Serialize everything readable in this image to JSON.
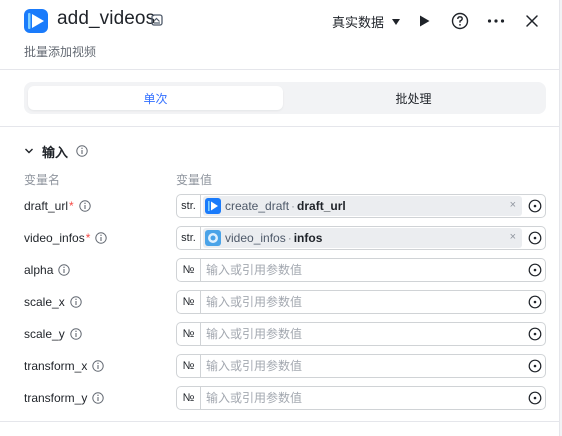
{
  "header": {
    "title": "add_videos",
    "subtitle": "批量添加视频",
    "data_mode": "真实数据"
  },
  "tabs": [
    {
      "label": "单次",
      "active": true
    },
    {
      "label": "批处理",
      "active": false
    }
  ],
  "section": {
    "title": "输入",
    "col_name": "变量名",
    "col_value": "变量值"
  },
  "params": [
    {
      "name": "draft_url",
      "required": true,
      "type_tag": "str.",
      "ref_node": "create_draft",
      "ref_var": "draft_url",
      "placeholder": ""
    },
    {
      "name": "video_infos",
      "required": true,
      "type_tag": "str.",
      "ref_node": "video_infos",
      "ref_var": "infos",
      "placeholder": ""
    },
    {
      "name": "alpha",
      "required": false,
      "type_tag": "№",
      "placeholder": "输入或引用参数值"
    },
    {
      "name": "scale_x",
      "required": false,
      "type_tag": "№",
      "placeholder": "输入或引用参数值"
    },
    {
      "name": "scale_y",
      "required": false,
      "type_tag": "№",
      "placeholder": "输入或引用参数值"
    },
    {
      "name": "transform_x",
      "required": false,
      "type_tag": "№",
      "placeholder": "输入或引用参数值"
    },
    {
      "name": "transform_y",
      "required": false,
      "type_tag": "№",
      "placeholder": "输入或引用参数值"
    }
  ],
  "required_mark": "*",
  "clear_glyph": "×",
  "colors": {
    "accent": "#3370ff",
    "app_icon": "#1a7bfb",
    "required": "#f54a45"
  },
  "icons": [
    "video-app-icon",
    "edit-icon",
    "play-icon",
    "help-icon",
    "more-icon",
    "close-icon",
    "chevron-down-icon",
    "info-icon",
    "target-icon"
  ]
}
